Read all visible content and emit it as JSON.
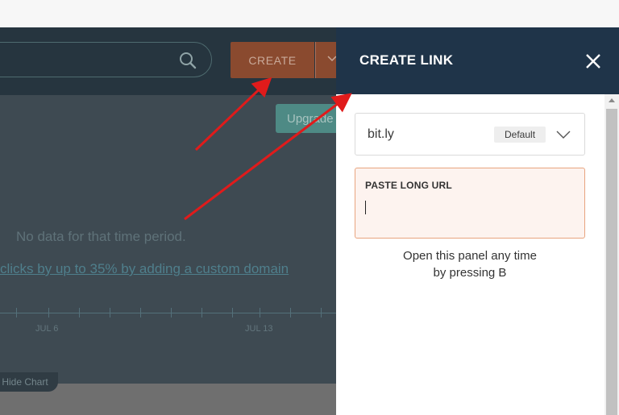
{
  "dashboard": {
    "create_label": "CREATE",
    "upgrade_label": "Upgrade",
    "no_data_text": "No data for that time period.",
    "promo_link": "clicks by up to 35% by adding a custom domain",
    "axis_labels": [
      "JUL 6",
      "JUL 13"
    ],
    "hide_chart_label": "Hide Chart"
  },
  "panel": {
    "title": "CREATE LINK",
    "domain_value": "bit.ly",
    "default_badge": "Default",
    "url_label": "PASTE LONG URL",
    "url_value": "",
    "hint_line1": "Open this panel any time",
    "hint_line2": "by pressing B"
  },
  "icons": [
    "search-icon",
    "chevron-down-icon",
    "close-icon"
  ],
  "colors": {
    "panel_header": "#1f3449",
    "create_button": "#8a4a2f",
    "url_border": "#e8a47f",
    "annotation_arrow": "#e01b1b"
  }
}
